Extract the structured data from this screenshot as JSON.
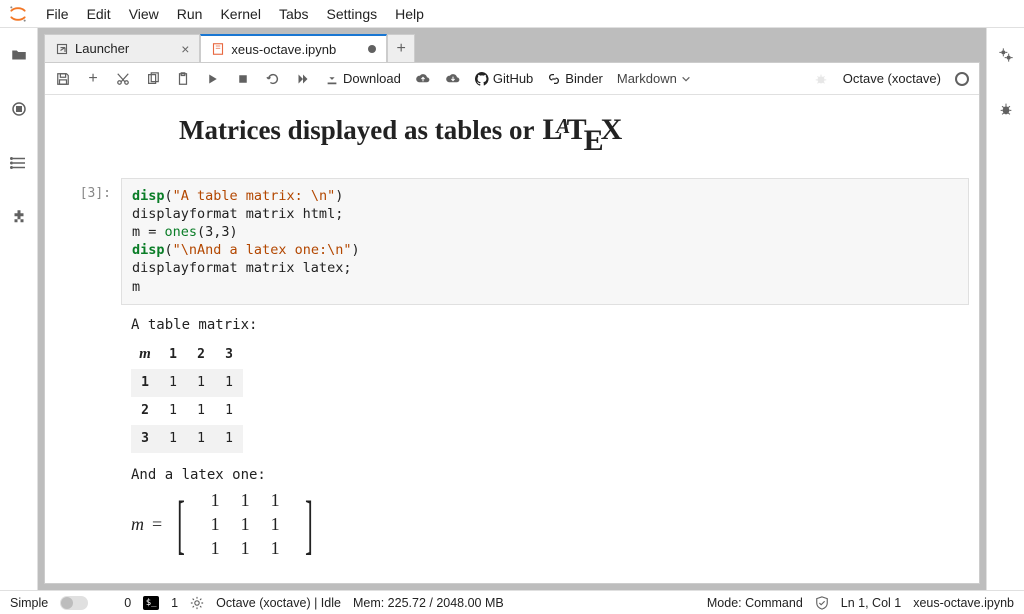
{
  "menus": [
    "File",
    "Edit",
    "View",
    "Run",
    "Kernel",
    "Tabs",
    "Settings",
    "Help"
  ],
  "tabs": {
    "launcher": "Launcher",
    "notebook": "xeus-octave.ipynb"
  },
  "toolbar": {
    "download": "Download",
    "github": "GitHub",
    "binder": "Binder",
    "celltype": "Markdown",
    "kernel_name": "Octave (xoctave)"
  },
  "notebook": {
    "heading": "Matrices displayed as tables or",
    "prompt": "[3]:",
    "code": {
      "l1a": "disp",
      "l1b": "(",
      "l1c": "\"A table matrix: \\n\"",
      "l1d": ")",
      "l2": "displayformat matrix html;",
      "l3a": "m = ",
      "l3b": "ones",
      "l3c": "(3,3)",
      "l4a": "disp",
      "l4b": "(",
      "l4c": "\"\\nAnd a latex one:\\n\"",
      "l4d": ")",
      "l5": "displayformat matrix latex;",
      "l6": "m"
    },
    "out_text1": "A table matrix:",
    "table": {
      "corner": "m",
      "cols": [
        "1",
        "2",
        "3"
      ],
      "rows": [
        {
          "h": "1",
          "v": [
            "1",
            "1",
            "1"
          ]
        },
        {
          "h": "2",
          "v": [
            "1",
            "1",
            "1"
          ]
        },
        {
          "h": "3",
          "v": [
            "1",
            "1",
            "1"
          ]
        }
      ]
    },
    "out_text2": "And a latex one:",
    "latex": {
      "var": "m",
      "eq": "=",
      "rows": [
        [
          "1",
          "1",
          "1"
        ],
        [
          "1",
          "1",
          "1"
        ],
        [
          "1",
          "1",
          "1"
        ]
      ]
    }
  },
  "status": {
    "simple": "Simple",
    "zero": "0",
    "one": "1",
    "kernel": "Octave (xoctave) | Idle",
    "mem": "Mem: 225.72 / 2048.00 MB",
    "mode": "Mode: Command",
    "ln": "Ln 1, Col 1",
    "file": "xeus-octave.ipynb"
  }
}
